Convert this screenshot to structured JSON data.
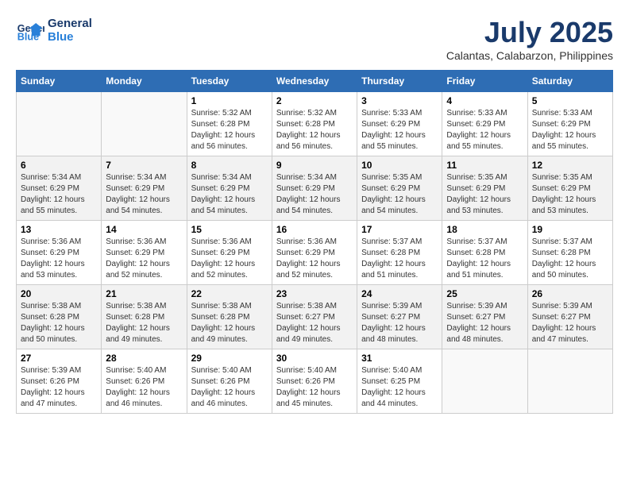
{
  "header": {
    "logo_line1": "General",
    "logo_line2": "Blue",
    "month_title": "July 2025",
    "location": "Calantas, Calabarzon, Philippines"
  },
  "weekdays": [
    "Sunday",
    "Monday",
    "Tuesday",
    "Wednesday",
    "Thursday",
    "Friday",
    "Saturday"
  ],
  "weeks": [
    [
      {
        "day": "",
        "info": ""
      },
      {
        "day": "",
        "info": ""
      },
      {
        "day": "1",
        "info": "Sunrise: 5:32 AM\nSunset: 6:28 PM\nDaylight: 12 hours and 56 minutes."
      },
      {
        "day": "2",
        "info": "Sunrise: 5:32 AM\nSunset: 6:28 PM\nDaylight: 12 hours and 56 minutes."
      },
      {
        "day": "3",
        "info": "Sunrise: 5:33 AM\nSunset: 6:29 PM\nDaylight: 12 hours and 55 minutes."
      },
      {
        "day": "4",
        "info": "Sunrise: 5:33 AM\nSunset: 6:29 PM\nDaylight: 12 hours and 55 minutes."
      },
      {
        "day": "5",
        "info": "Sunrise: 5:33 AM\nSunset: 6:29 PM\nDaylight: 12 hours and 55 minutes."
      }
    ],
    [
      {
        "day": "6",
        "info": "Sunrise: 5:34 AM\nSunset: 6:29 PM\nDaylight: 12 hours and 55 minutes."
      },
      {
        "day": "7",
        "info": "Sunrise: 5:34 AM\nSunset: 6:29 PM\nDaylight: 12 hours and 54 minutes."
      },
      {
        "day": "8",
        "info": "Sunrise: 5:34 AM\nSunset: 6:29 PM\nDaylight: 12 hours and 54 minutes."
      },
      {
        "day": "9",
        "info": "Sunrise: 5:34 AM\nSunset: 6:29 PM\nDaylight: 12 hours and 54 minutes."
      },
      {
        "day": "10",
        "info": "Sunrise: 5:35 AM\nSunset: 6:29 PM\nDaylight: 12 hours and 54 minutes."
      },
      {
        "day": "11",
        "info": "Sunrise: 5:35 AM\nSunset: 6:29 PM\nDaylight: 12 hours and 53 minutes."
      },
      {
        "day": "12",
        "info": "Sunrise: 5:35 AM\nSunset: 6:29 PM\nDaylight: 12 hours and 53 minutes."
      }
    ],
    [
      {
        "day": "13",
        "info": "Sunrise: 5:36 AM\nSunset: 6:29 PM\nDaylight: 12 hours and 53 minutes."
      },
      {
        "day": "14",
        "info": "Sunrise: 5:36 AM\nSunset: 6:29 PM\nDaylight: 12 hours and 52 minutes."
      },
      {
        "day": "15",
        "info": "Sunrise: 5:36 AM\nSunset: 6:29 PM\nDaylight: 12 hours and 52 minutes."
      },
      {
        "day": "16",
        "info": "Sunrise: 5:36 AM\nSunset: 6:29 PM\nDaylight: 12 hours and 52 minutes."
      },
      {
        "day": "17",
        "info": "Sunrise: 5:37 AM\nSunset: 6:28 PM\nDaylight: 12 hours and 51 minutes."
      },
      {
        "day": "18",
        "info": "Sunrise: 5:37 AM\nSunset: 6:28 PM\nDaylight: 12 hours and 51 minutes."
      },
      {
        "day": "19",
        "info": "Sunrise: 5:37 AM\nSunset: 6:28 PM\nDaylight: 12 hours and 50 minutes."
      }
    ],
    [
      {
        "day": "20",
        "info": "Sunrise: 5:38 AM\nSunset: 6:28 PM\nDaylight: 12 hours and 50 minutes."
      },
      {
        "day": "21",
        "info": "Sunrise: 5:38 AM\nSunset: 6:28 PM\nDaylight: 12 hours and 49 minutes."
      },
      {
        "day": "22",
        "info": "Sunrise: 5:38 AM\nSunset: 6:28 PM\nDaylight: 12 hours and 49 minutes."
      },
      {
        "day": "23",
        "info": "Sunrise: 5:38 AM\nSunset: 6:27 PM\nDaylight: 12 hours and 49 minutes."
      },
      {
        "day": "24",
        "info": "Sunrise: 5:39 AM\nSunset: 6:27 PM\nDaylight: 12 hours and 48 minutes."
      },
      {
        "day": "25",
        "info": "Sunrise: 5:39 AM\nSunset: 6:27 PM\nDaylight: 12 hours and 48 minutes."
      },
      {
        "day": "26",
        "info": "Sunrise: 5:39 AM\nSunset: 6:27 PM\nDaylight: 12 hours and 47 minutes."
      }
    ],
    [
      {
        "day": "27",
        "info": "Sunrise: 5:39 AM\nSunset: 6:26 PM\nDaylight: 12 hours and 47 minutes."
      },
      {
        "day": "28",
        "info": "Sunrise: 5:40 AM\nSunset: 6:26 PM\nDaylight: 12 hours and 46 minutes."
      },
      {
        "day": "29",
        "info": "Sunrise: 5:40 AM\nSunset: 6:26 PM\nDaylight: 12 hours and 46 minutes."
      },
      {
        "day": "30",
        "info": "Sunrise: 5:40 AM\nSunset: 6:26 PM\nDaylight: 12 hours and 45 minutes."
      },
      {
        "day": "31",
        "info": "Sunrise: 5:40 AM\nSunset: 6:25 PM\nDaylight: 12 hours and 44 minutes."
      },
      {
        "day": "",
        "info": ""
      },
      {
        "day": "",
        "info": ""
      }
    ]
  ]
}
